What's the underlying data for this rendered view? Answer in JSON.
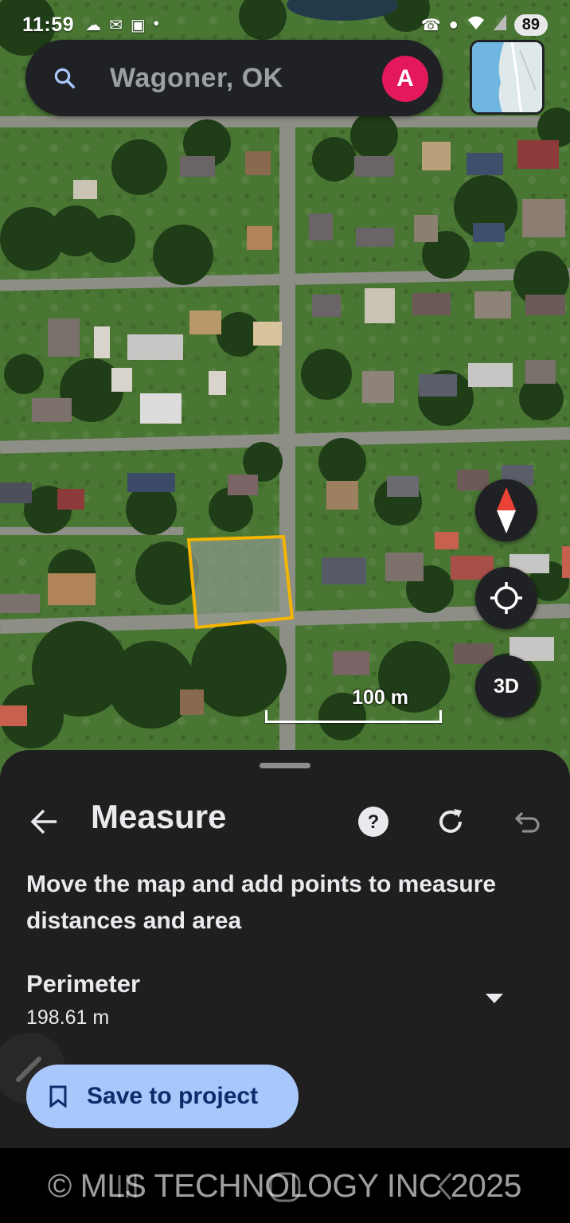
{
  "status_bar": {
    "time": "11:59",
    "battery": "89",
    "left_icons": [
      "snapchat-icon",
      "mail-icon",
      "screenshot-icon",
      "dot-icon"
    ],
    "right_icons": [
      "no-call-icon",
      "location-icon",
      "wifi-icon",
      "signal-icon"
    ]
  },
  "search": {
    "text": "Wagoner, OK",
    "avatar_letter": "A",
    "avatar_color": "#e3195b"
  },
  "map": {
    "scale_label": "100 m",
    "button_3d": "3D",
    "measure_outline_color": "#f4b400"
  },
  "sheet": {
    "title": "Measure",
    "description": "Move the map and add points to measure distances and area",
    "perimeter_label": "Perimeter",
    "perimeter_value": "198.61 m",
    "save_label": "Save to project",
    "accent_color": "#a8c7fa"
  },
  "watermark": "© MLS TECHNOLOGY INC 2025"
}
